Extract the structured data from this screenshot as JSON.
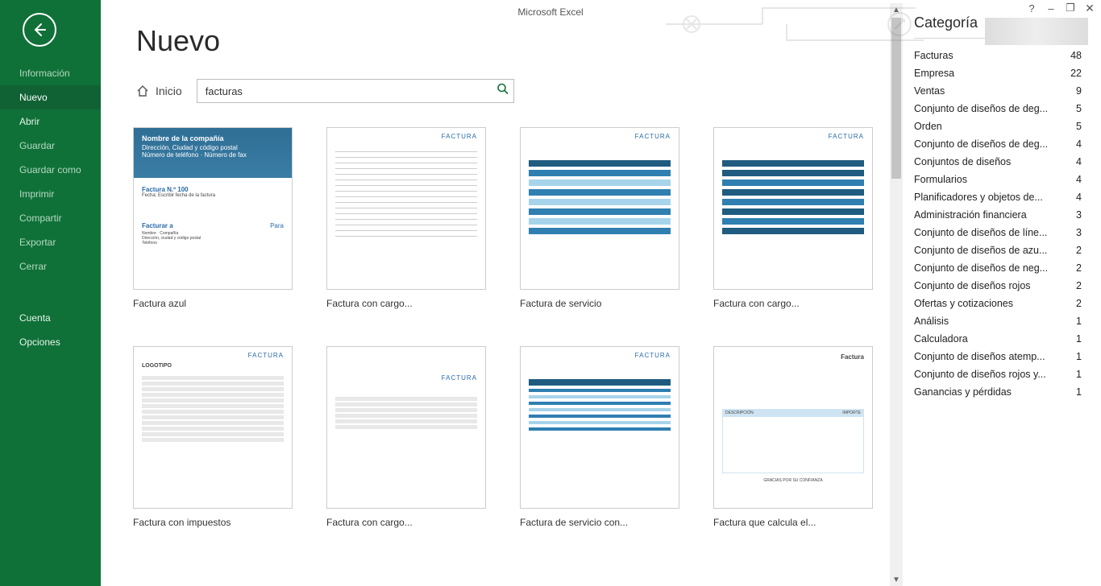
{
  "app_title": "Microsoft Excel",
  "window_controls": {
    "help": "?",
    "minimize": "–",
    "restore": "❐",
    "close": "✕"
  },
  "sidebar": {
    "items": [
      {
        "label": "Información",
        "dim": true
      },
      {
        "label": "Nuevo",
        "active": true
      },
      {
        "label": "Abrir"
      },
      {
        "label": "Guardar",
        "dim": true
      },
      {
        "label": "Guardar como",
        "dim": true
      },
      {
        "label": "Imprimir",
        "dim": true
      },
      {
        "label": "Compartir",
        "dim": true
      },
      {
        "label": "Exportar",
        "dim": true
      },
      {
        "label": "Cerrar",
        "dim": true
      }
    ],
    "footer": [
      {
        "label": "Cuenta"
      },
      {
        "label": "Opciones"
      }
    ]
  },
  "page": {
    "title": "Nuevo",
    "breadcrumb_home": "Inicio",
    "search_value": "facturas"
  },
  "templates": [
    {
      "title": "Factura azul",
      "style": "blue-header"
    },
    {
      "title": "Factura con cargo...",
      "style": "plain"
    },
    {
      "title": "Factura de servicio",
      "style": "bars-light"
    },
    {
      "title": "Factura con cargo...",
      "style": "bars-dark"
    },
    {
      "title": "Factura con impuestos",
      "style": "logo-stripes"
    },
    {
      "title": "Factura con cargo...",
      "style": "center-table"
    },
    {
      "title": "Factura de servicio con...",
      "style": "bars-lined"
    },
    {
      "title": "Factura que calcula el...",
      "style": "simple-blue"
    }
  ],
  "categories": {
    "heading": "Categoría",
    "items": [
      {
        "name": "Facturas",
        "count": 48
      },
      {
        "name": "Empresa",
        "count": 22
      },
      {
        "name": "Ventas",
        "count": 9
      },
      {
        "name": "Conjunto de diseños de deg...",
        "count": 5
      },
      {
        "name": "Orden",
        "count": 5
      },
      {
        "name": "Conjunto de diseños de deg...",
        "count": 4
      },
      {
        "name": "Conjuntos de diseños",
        "count": 4
      },
      {
        "name": "Formularios",
        "count": 4
      },
      {
        "name": "Planificadores y objetos de...",
        "count": 4
      },
      {
        "name": "Administración financiera",
        "count": 3
      },
      {
        "name": "Conjunto de diseños de líne...",
        "count": 3
      },
      {
        "name": "Conjunto de diseños de azu...",
        "count": 2
      },
      {
        "name": "Conjunto de diseños de neg...",
        "count": 2
      },
      {
        "name": "Conjunto de diseños rojos",
        "count": 2
      },
      {
        "name": "Ofertas y cotizaciones",
        "count": 2
      },
      {
        "name": "Análisis",
        "count": 1
      },
      {
        "name": "Calculadora",
        "count": 1
      },
      {
        "name": "Conjunto de diseños atemp...",
        "count": 1
      },
      {
        "name": "Conjunto de diseños rojos y...",
        "count": 1
      },
      {
        "name": "Ganancias y pérdidas",
        "count": 1
      }
    ]
  },
  "thumb_text": {
    "company": "Nombre de la compañía",
    "address": "Dirección, Ciudad y código postal\nNúmero de teléfono · Número de fax",
    "invoice_no": "Factura N.º 100",
    "invoice_date": "Fecha: Escribir fecha de la factura",
    "bill_to": "Facturar a",
    "para": "Para",
    "bill_lines": "Nombre · Compañía\nDirección, ciudad y código postal\nTeléfono",
    "factura": "FACTURA",
    "factura_title": "Factura",
    "logotipo": "LOGOTIPO",
    "gracias": "GRACIAS POR SU CONFIANZA",
    "descripcion": "DESCRIPCIÓN",
    "importe": "IMPORTE"
  }
}
